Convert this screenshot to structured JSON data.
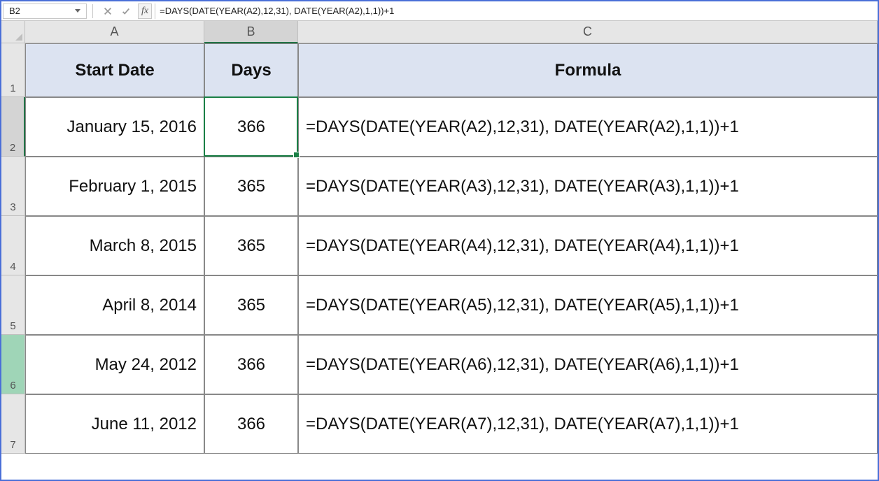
{
  "formula_bar": {
    "name_box": "B2",
    "fx_label": "fx",
    "formula": "=DAYS(DATE(YEAR(A2),12,31), DATE(YEAR(A2),1,1))+1"
  },
  "columns": {
    "A": "A",
    "B": "B",
    "C": "C"
  },
  "row_numbers": [
    "1",
    "2",
    "3",
    "4",
    "5",
    "6",
    "7"
  ],
  "headers": {
    "start_date": "Start Date",
    "days": "Days",
    "formula": "Formula"
  },
  "rows": [
    {
      "start_date": "January 15, 2016",
      "days": "366",
      "formula": "=DAYS(DATE(YEAR(A2),12,31), DATE(YEAR(A2),1,1))+1"
    },
    {
      "start_date": "February 1, 2015",
      "days": "365",
      "formula": "=DAYS(DATE(YEAR(A3),12,31), DATE(YEAR(A3),1,1))+1"
    },
    {
      "start_date": "March 8, 2015",
      "days": "365",
      "formula": "=DAYS(DATE(YEAR(A4),12,31), DATE(YEAR(A4),1,1))+1"
    },
    {
      "start_date": "April 8, 2014",
      "days": "365",
      "formula": "=DAYS(DATE(YEAR(A5),12,31), DATE(YEAR(A5),1,1))+1"
    },
    {
      "start_date": "May 24, 2012",
      "days": "366",
      "formula": "=DAYS(DATE(YEAR(A6),12,31), DATE(YEAR(A6),1,1))+1"
    },
    {
      "start_date": "June 11, 2012",
      "days": "366",
      "formula": "=DAYS(DATE(YEAR(A7),12,31), DATE(YEAR(A7),1,1))+1"
    }
  ],
  "layout": {
    "header_row_h": 77,
    "data_row_h": 85,
    "active_column": "B",
    "active_row_index": 1,
    "highlighted_row_index": 5
  },
  "chart_data": {
    "type": "table",
    "columns": [
      "Start Date",
      "Days",
      "Formula"
    ],
    "rows": [
      [
        "January 15, 2016",
        366,
        "=DAYS(DATE(YEAR(A2),12,31), DATE(YEAR(A2),1,1))+1"
      ],
      [
        "February 1, 2015",
        365,
        "=DAYS(DATE(YEAR(A3),12,31), DATE(YEAR(A3),1,1))+1"
      ],
      [
        "March 8, 2015",
        365,
        "=DAYS(DATE(YEAR(A4),12,31), DATE(YEAR(A4),1,1))+1"
      ],
      [
        "April 8, 2014",
        365,
        "=DAYS(DATE(YEAR(A5),12,31), DATE(YEAR(A5),1,1))+1"
      ],
      [
        "May 24, 2012",
        366,
        "=DAYS(DATE(YEAR(A6),12,31), DATE(YEAR(A6),1,1))+1"
      ],
      [
        "June 11, 2012",
        366,
        "=DAYS(DATE(YEAR(A7),12,31), DATE(YEAR(A7),1,1))+1"
      ]
    ]
  }
}
